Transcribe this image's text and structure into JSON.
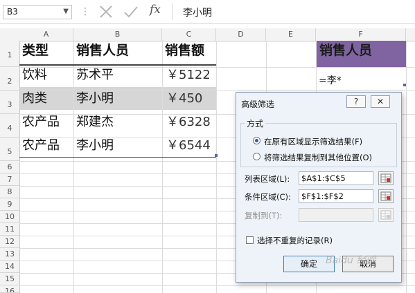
{
  "formula_bar": {
    "name_box": "B3",
    "content": "李小明",
    "fx_label": "fx",
    "icons": [
      "chevron-down-icon",
      "more-icon",
      "cancel-x-icon",
      "enter-check-icon",
      "function-icon"
    ]
  },
  "columns": [
    "A",
    "B",
    "C",
    "D",
    "E",
    "F"
  ],
  "rows": [
    "1",
    "2",
    "3",
    "4",
    "5",
    "6",
    "7",
    "8",
    "9",
    "10",
    "11",
    "12",
    "13",
    "14",
    "15",
    "16"
  ],
  "table": {
    "headers": [
      "类型",
      "销售人员",
      "销售额"
    ],
    "rows": [
      [
        "饮料",
        "苏术平",
        "￥5122"
      ],
      [
        "肉类",
        "李小明",
        "￥450"
      ],
      [
        "农产品",
        "郑建杰",
        "￥6328"
      ],
      [
        "农产品",
        "李小明",
        "￥6544"
      ]
    ],
    "selected_row": "3"
  },
  "criteria": {
    "header": "销售人员",
    "value": "=李*",
    "header_fill": "#8064a2"
  },
  "dialog": {
    "title": "高级筛选",
    "help_button": "?",
    "close_button": "✕",
    "group_label": "方式",
    "radio1": "在原有区域显示筛选结果(F)",
    "radio2": "将筛选结果复制到其他位置(O)",
    "list_range_label": "列表区域(L):",
    "list_range_value": "$A$1:$C$5",
    "criteria_range_label": "条件区域(C):",
    "criteria_range_value": "$F$1:$F$2",
    "copy_to_label": "复制到(T):",
    "copy_to_value": "",
    "unique_label": "选择不重复的记录(R)",
    "ok": "确定",
    "cancel": "取消",
    "selected_mode": "在原有区域显示筛选结果"
  },
  "watermark": "Baidu 经验"
}
